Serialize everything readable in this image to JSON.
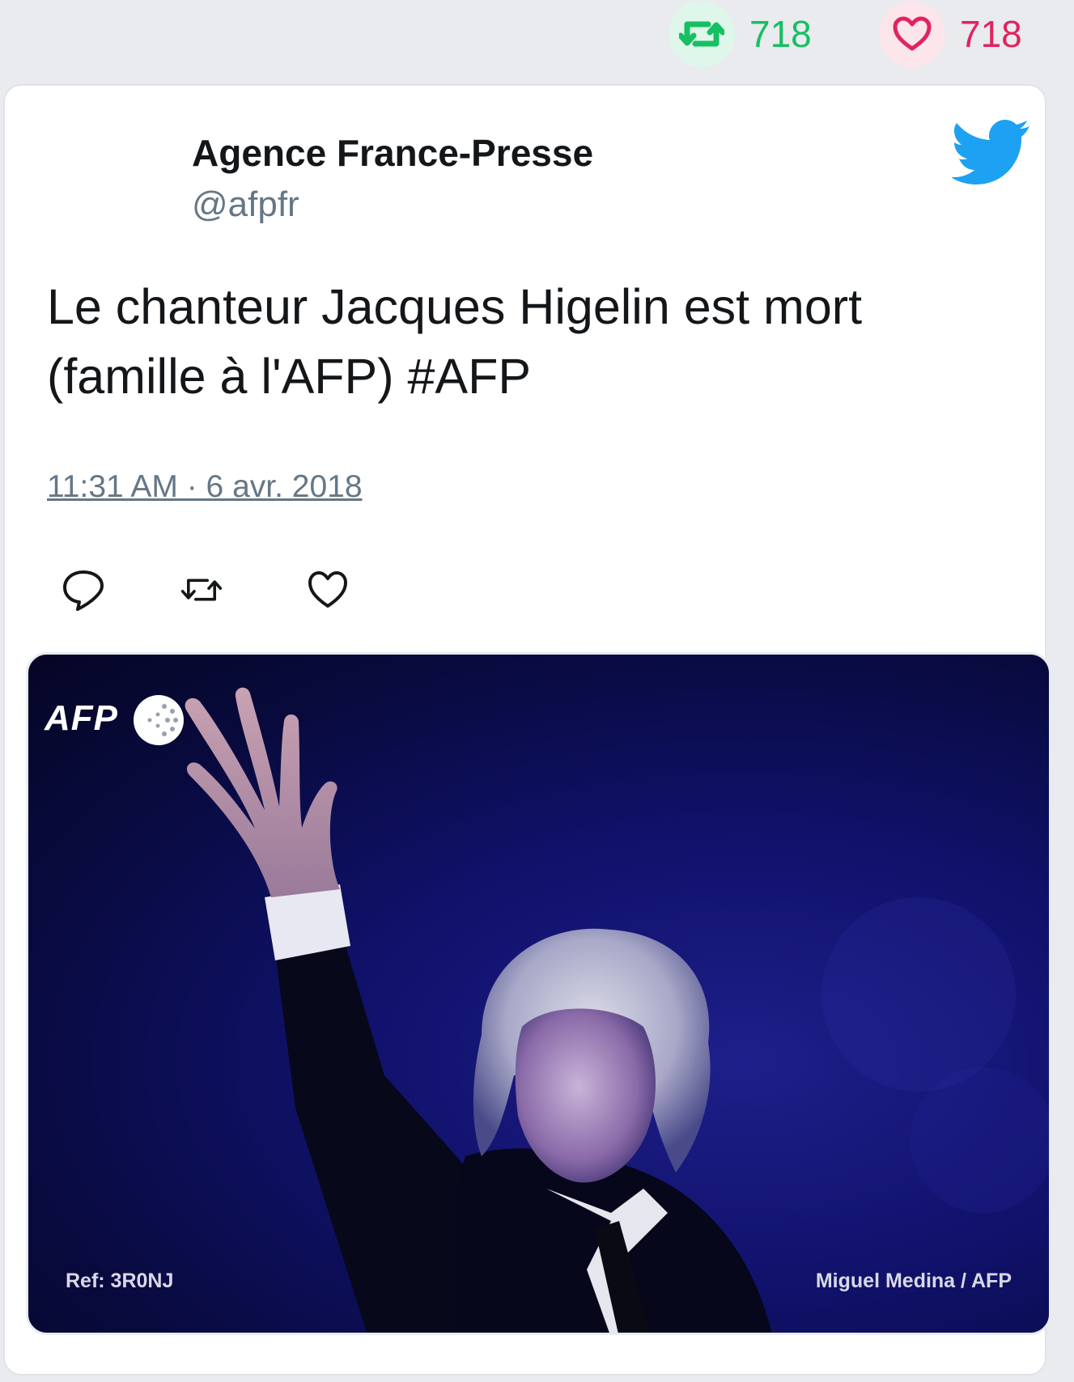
{
  "stats": {
    "retweet_count": "718",
    "like_count": "718"
  },
  "tweet": {
    "author_name": "Agence France-Presse",
    "author_handle": "@afpfr",
    "text": "Le chanteur Jacques Higelin est mort (famille à l'AFP) #AFP",
    "timestamp": "11:31 AM · 6 avr. 2018",
    "actions": [
      "reply-icon",
      "retweet-icon",
      "like-icon"
    ]
  },
  "photo": {
    "logo_text": "AFP",
    "ref": "Ref: 3R0NJ",
    "credit": "Miguel Medina / AFP"
  },
  "colors": {
    "retweet_green": "#17bf63",
    "like_red": "#e0245e",
    "twitter_blue": "#1da1f2",
    "muted_gray": "#657786"
  }
}
